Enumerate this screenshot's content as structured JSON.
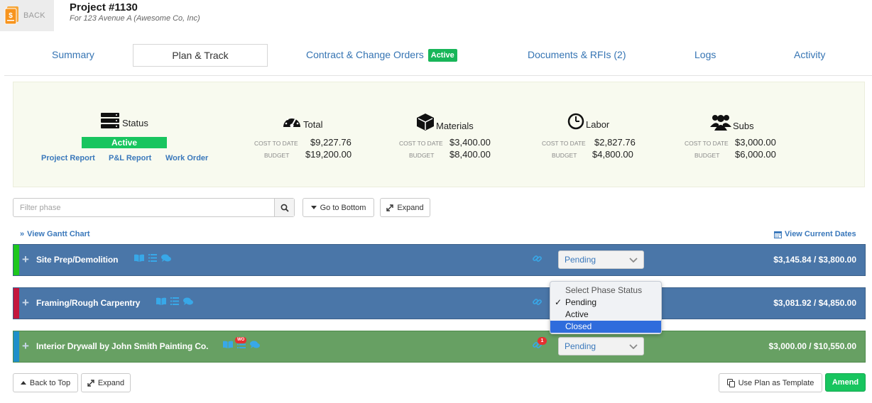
{
  "header": {
    "back_label": "BACK",
    "project_title": "Project #1130",
    "project_subtitle": "For 123 Avenue A (Awesome Co, Inc)",
    "icon": "dollar-document-icon"
  },
  "tabs": [
    {
      "label": "Summary",
      "active": false
    },
    {
      "label": "Plan & Track",
      "active": true
    },
    {
      "label": "Contract & Change Orders",
      "active": false,
      "badge": "Active"
    },
    {
      "label": "Documents & RFIs (2)",
      "active": false
    },
    {
      "label": "Logs",
      "active": false
    },
    {
      "label": "Activity",
      "active": false
    }
  ],
  "summary": {
    "status": {
      "label": "Status",
      "value": "Active",
      "links": [
        "Project Report",
        "P&L Report",
        "Work Order"
      ]
    },
    "cost_to_date_label": "COST TO DATE",
    "budget_label": "BUDGET",
    "total": {
      "label": "Total",
      "cost_to_date": "$9,227.76",
      "budget": "$19,200.00"
    },
    "materials": {
      "label": "Materials",
      "cost_to_date": "$3,400.00",
      "budget": "$8,400.00"
    },
    "labor": {
      "label": "Labor",
      "cost_to_date": "$2,827.76",
      "budget": "$4,800.00"
    },
    "subs": {
      "label": "Subs",
      "cost_to_date": "$3,000.00",
      "budget": "$6,000.00"
    }
  },
  "toolbar": {
    "filter_placeholder": "Filter phase",
    "go_to_bottom": "Go to Bottom",
    "expand": "Expand",
    "view_gantt": "View Gantt Chart",
    "view_current_dates": "View Current Dates"
  },
  "phases": [
    {
      "name": "Site Prep/Demolition",
      "status": "Pending",
      "amount": "$3,145.84 / $3,800.00",
      "color": "#4a76a8",
      "bar_color": "#1ec71e"
    },
    {
      "name": "Framing/Rough Carpentry",
      "status": "",
      "amount": "$3,081.92 / $4,850.00",
      "color": "#4a76a8",
      "bar_color": "#c4173e"
    },
    {
      "name": "Interior Drywall by John Smith Painting Co.",
      "status": "Pending",
      "amount": "$3,000.00 / $10,550.00",
      "color": "#67a063",
      "bar_color": "#1e8fc9",
      "wo_badge": "WO",
      "link_badge": "1"
    }
  ],
  "dropdown": {
    "header": "Select Phase Status",
    "options": [
      {
        "label": "Pending",
        "checked": true
      },
      {
        "label": "Active",
        "checked": false
      },
      {
        "label": "Closed",
        "selected": true
      }
    ]
  },
  "footer": {
    "back_to_top": "Back to Top",
    "expand": "Expand",
    "use_plan_as_template": "Use Plan as Template",
    "amend": "Amend"
  },
  "colors": {
    "link": "#3a78bb",
    "active_green": "#18c55f",
    "phase_blue": "#4a76a8",
    "phase_green": "#67a063"
  }
}
